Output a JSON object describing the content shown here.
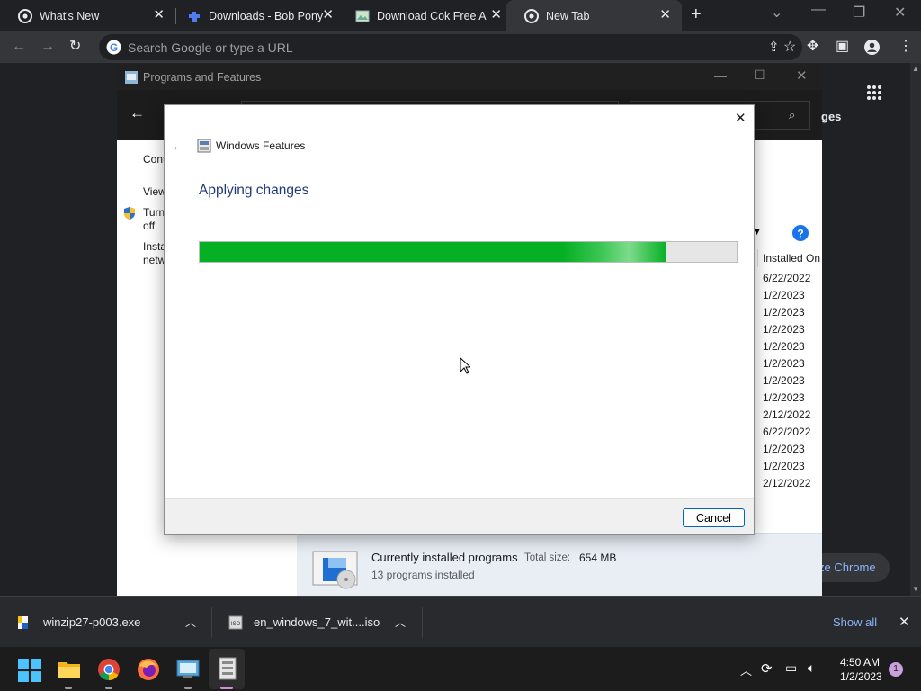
{
  "chrome": {
    "tabs": [
      {
        "label": "What's New",
        "icon": "chrome-icon"
      },
      {
        "label": "Downloads - Bob Pony",
        "icon": "puzzle-icon"
      },
      {
        "label": "Download Cok Free Au",
        "icon": "image-icon"
      },
      {
        "label": "New Tab",
        "icon": "chrome-icon"
      }
    ],
    "omnibox_placeholder": "Search Google or type a URL"
  },
  "programs_features": {
    "title": "Programs and Features",
    "right_header_fragment": "ges",
    "left_links": [
      "Cont",
      "View",
      "Turn",
      "off",
      "Insta",
      "netw"
    ],
    "column_header": "Installed On",
    "installed_dates": [
      "6/22/2022",
      "1/2/2023",
      "1/2/2023",
      "1/2/2023",
      "1/2/2023",
      "1/2/2023",
      "1/2/2023",
      "1/2/2023",
      "2/12/2022",
      "6/22/2022",
      "1/2/2023",
      "1/2/2023",
      "2/12/2022"
    ],
    "status": {
      "title": "Currently installed programs",
      "total_size_label": "Total size:",
      "total_size_value": "654 MB",
      "count_text": "13 programs installed"
    },
    "customize_fragment": "ze Chrome"
  },
  "windows_features": {
    "title": "Windows Features",
    "heading": "Applying changes",
    "progress": 0.87,
    "cancel_label": "Cancel"
  },
  "downloads": {
    "items": [
      {
        "name": "winzip27-p003.exe"
      },
      {
        "name": "en_windows_7_wit....iso"
      }
    ],
    "show_all": "Show all"
  },
  "taskbar": {
    "time": "4:50 AM",
    "date": "1/2/2023",
    "notification_count": "1"
  },
  "colors": {
    "progress_green": "#06b025",
    "accent_blue": "#0067c0",
    "chrome_dark": "#202124"
  }
}
